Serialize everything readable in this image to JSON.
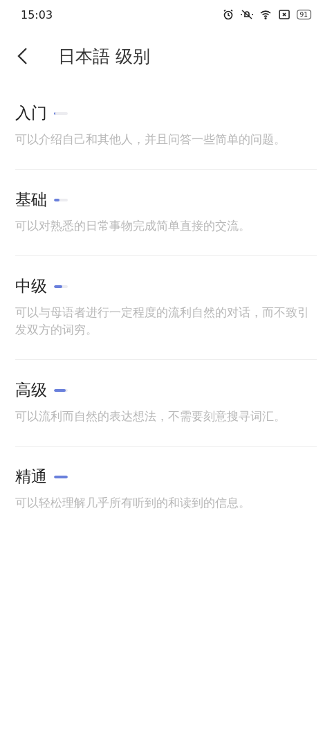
{
  "status_bar": {
    "time": "15:03",
    "battery": "91"
  },
  "header": {
    "title": "日本語 级别"
  },
  "levels": [
    {
      "name": "入门",
      "level": 0.1,
      "description": "可以介绍自己和其他人，并且问答一些简单的问题。"
    },
    {
      "name": "基础",
      "level": 0.4,
      "description": "可以对熟悉的日常事物完成简单直接的交流。"
    },
    {
      "name": "中级",
      "level": 0.6,
      "description": "可以与母语者进行一定程度的流利自然的对话，而不致引发双方的词穷。"
    },
    {
      "name": "高级",
      "level": 0.85,
      "description": "可以流利而自然的表达想法，不需要刻意搜寻词汇。"
    },
    {
      "name": "精通",
      "level": 1,
      "description": "可以轻松理解几乎所有听到的和读到的信息。"
    }
  ]
}
